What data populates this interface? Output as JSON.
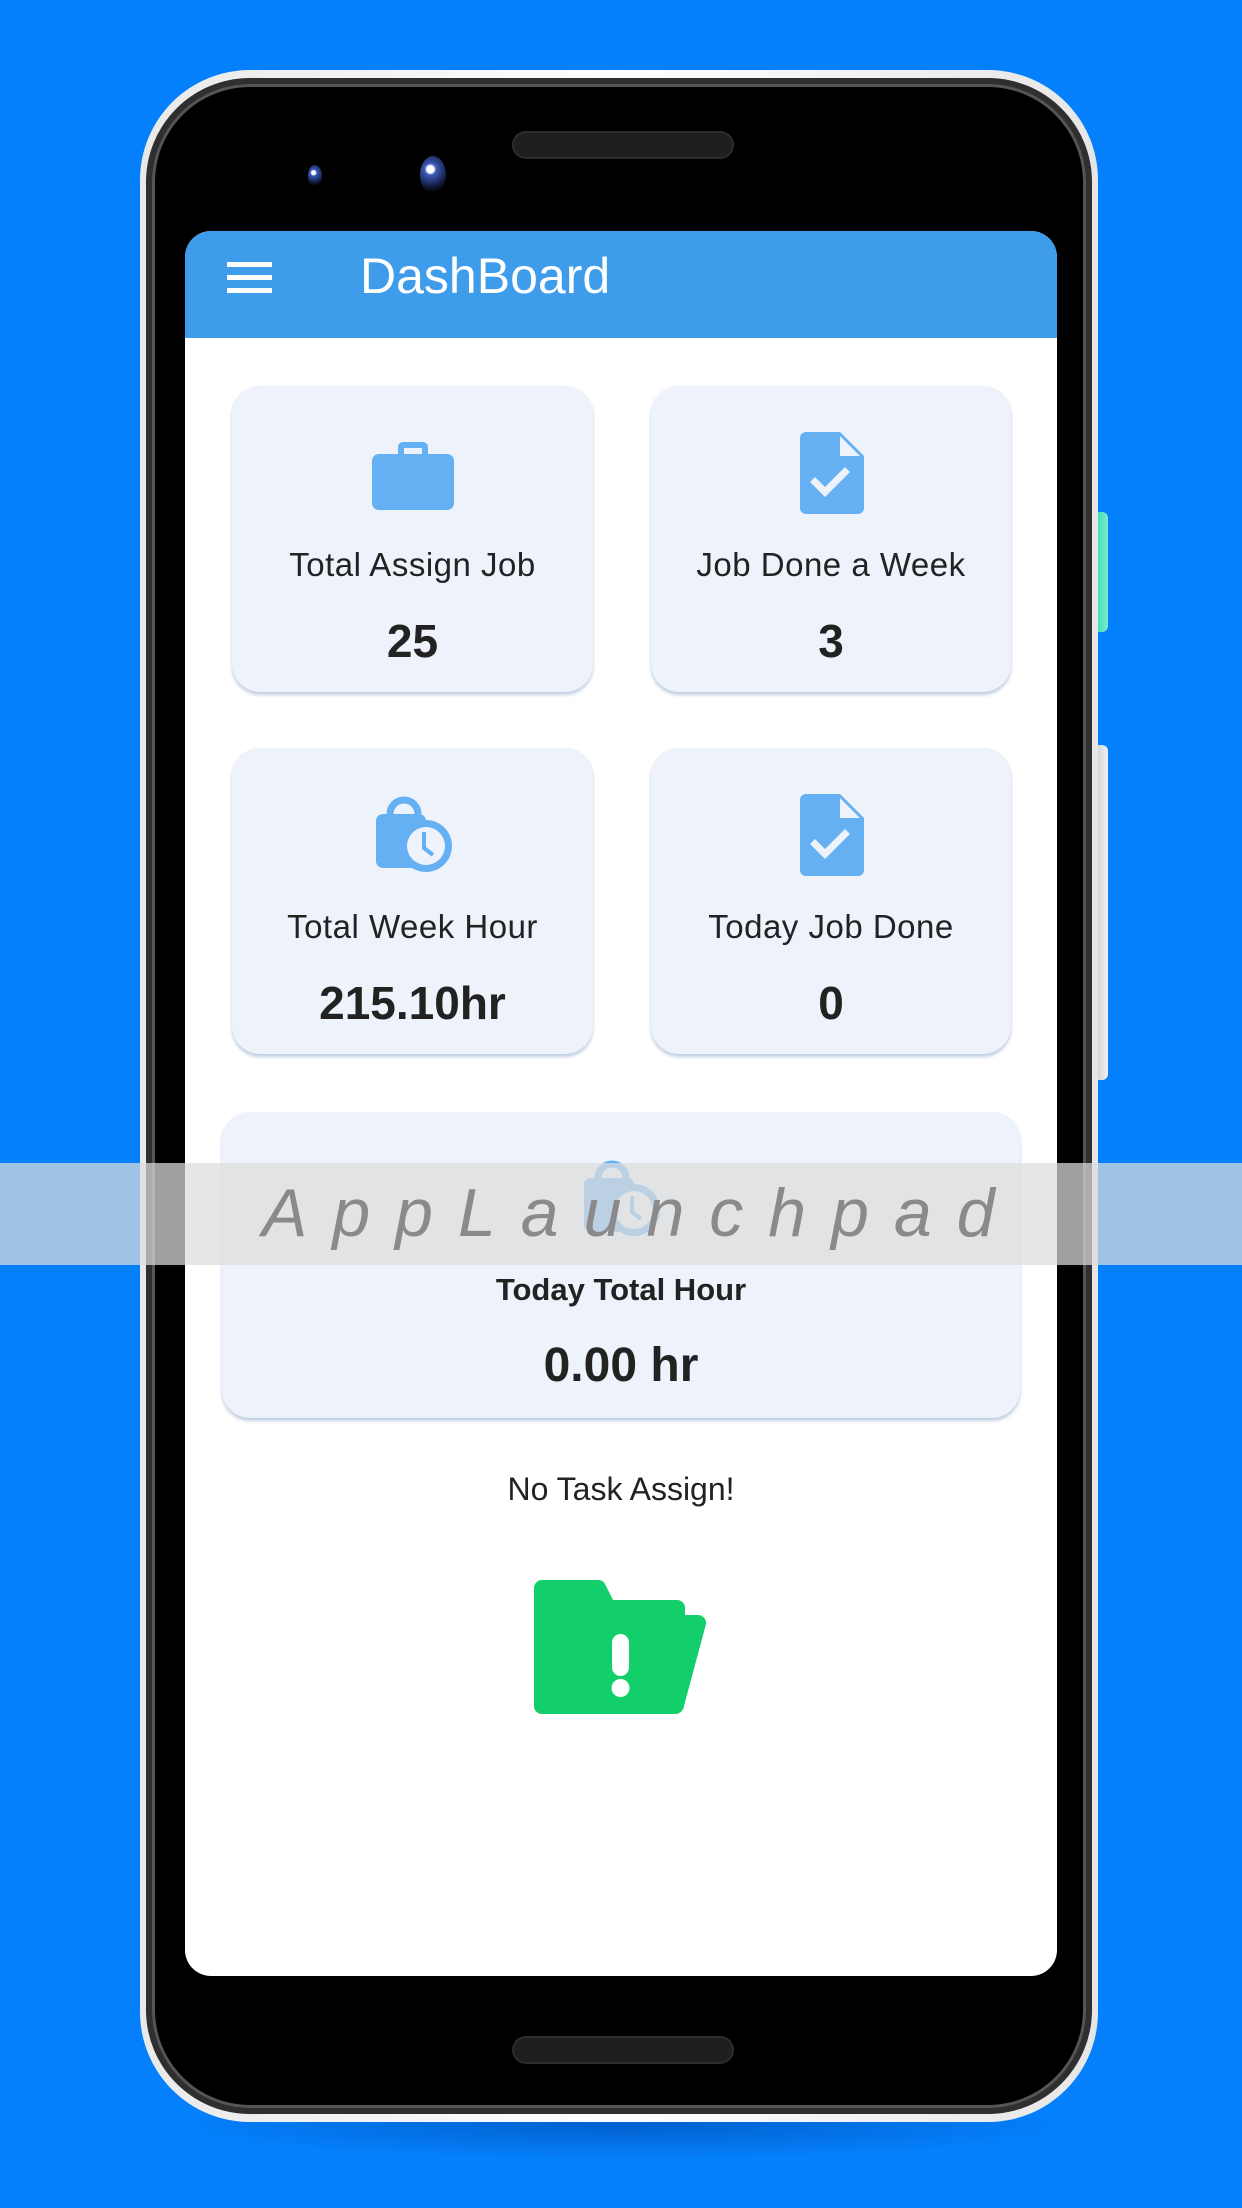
{
  "app": {
    "title": "DashBoard",
    "menu_icon": "hamburger-menu-icon",
    "header_color": "#3e9ceb",
    "background_color": "#0480fc",
    "accent_icon_color": "#64b0f2"
  },
  "stats": [
    {
      "icon": "briefcase-icon",
      "label": "Total Assign Job",
      "value": "25"
    },
    {
      "icon": "task-done-icon",
      "label": "Job Done a Week",
      "value": "3"
    },
    {
      "icon": "work-history-icon",
      "label": "Total Week Hour",
      "value": "215.10hr"
    },
    {
      "icon": "task-done-icon",
      "label": "Today Job Done",
      "value": "0"
    },
    {
      "icon": "work-history-icon",
      "label": "Today Total Hour",
      "value": "0.00 hr"
    }
  ],
  "empty_state": {
    "message": "No Task Assign!",
    "icon": "folder-alert-icon",
    "icon_color": "#13cf6b"
  },
  "watermark": {
    "text": "AppLaunchpad"
  }
}
